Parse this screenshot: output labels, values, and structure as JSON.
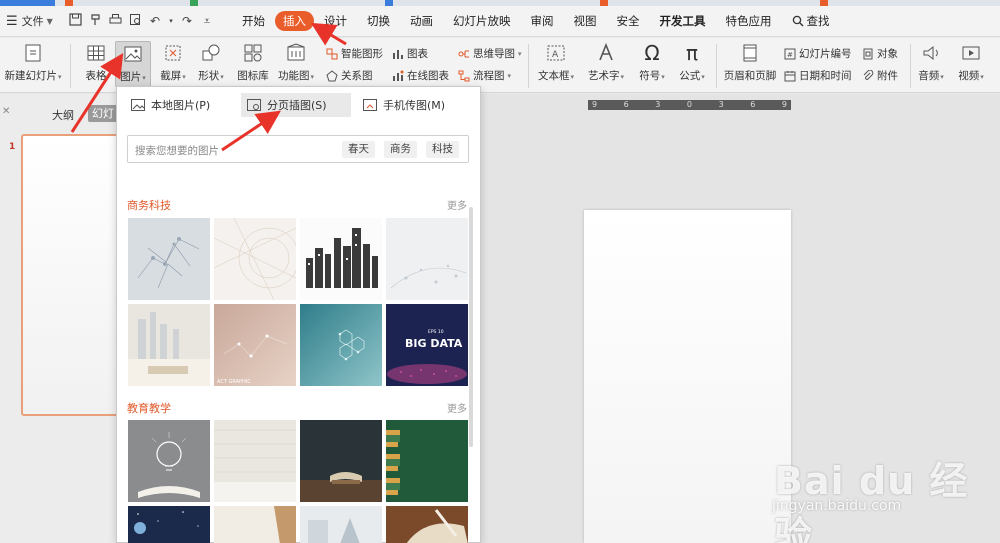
{
  "menubar": {
    "file_label": "文件",
    "tabs": [
      "开始",
      "插入",
      "设计",
      "切换",
      "动画",
      "幻灯片放映",
      "审阅",
      "视图",
      "安全",
      "开发工具",
      "特色应用"
    ],
    "active_tab": "插入",
    "search_label": "查找"
  },
  "ribbon": {
    "new_slide": "新建幻灯片",
    "table": "表格",
    "picture": "图片",
    "screenshot": "截屏",
    "shape": "形状",
    "icon_lib": "图标库",
    "func_chart": "功能图",
    "smart_graphic": "智能图形",
    "relation_chart": "关系图",
    "chart": "图表",
    "online_chart": "在线图表",
    "mind_map": "思维导图",
    "flowchart": "流程图",
    "textbox": "文本框",
    "wordart": "艺术字",
    "symbol": "符号",
    "formula": "公式",
    "header_footer": "页眉和页脚",
    "slide_number": "幻灯片编号",
    "object": "对象",
    "datetime": "日期和时间",
    "attachment": "附件",
    "audio": "音频",
    "video": "视频"
  },
  "left_panel": {
    "outline_tab": "大纲",
    "slide_tab": "幻灯",
    "slide_number": "1"
  },
  "ruler_ticks": [
    "9",
    "6",
    "3",
    "0",
    "3",
    "6",
    "9"
  ],
  "dropdown": {
    "local_picture": "本地图片(P)",
    "paged_insert": "分页插图(S)",
    "phone_transfer": "手机传图(M)",
    "search_placeholder": "搜索您想要的图片",
    "chips": [
      "春天",
      "商务",
      "科技"
    ],
    "section1_title": "商务科技",
    "section2_title": "教育教学",
    "more_label": "更多",
    "big_data_small": "EPS 10",
    "big_data": "BIG DATA",
    "abstract_text": "ACT GRAPHIC"
  },
  "watermark": {
    "brand": "Bai du 经验",
    "url": "jingyan.baidu.com"
  },
  "colors": {
    "accent": "#e85d2a",
    "annotation_arrow": "#e8332a"
  }
}
